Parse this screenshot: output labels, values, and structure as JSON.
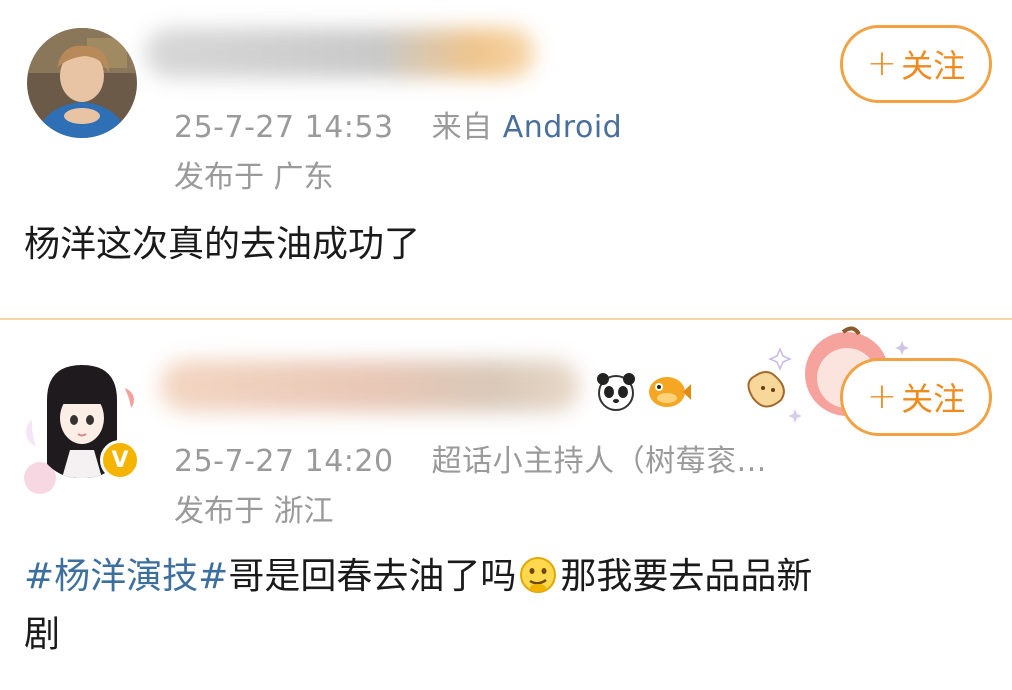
{
  "posts": [
    {
      "timestamp": "25-7-27 14:53",
      "source_prefix": "来自",
      "source": "Android",
      "location": "发布于 广东",
      "follow_label": "关注",
      "follow_plus": "+",
      "text": "杨洋这次真的去油成功了"
    },
    {
      "timestamp": "25-7-27 14:20",
      "source_prefix": "",
      "source": "超话小主持人（树莓衮...",
      "location": "发布于 浙江",
      "follow_label": "关注",
      "follow_plus": "+",
      "hashtag": "#杨洋演技#",
      "text_part1": "哥是回春去油了吗",
      "text_part2": "那我要去品品新",
      "text_line2": "剧"
    }
  ],
  "colors": {
    "follow_accent": "#ef8b1e",
    "hashtag": "#3d6f9e",
    "source_link": "#4a6f9a",
    "meta_gray": "#9a9a9a",
    "divider": "#f6d3a8"
  },
  "icons": [
    "panda-emoji-icon",
    "pufferfish-emoji-icon",
    "smirk-emoji-icon",
    "verified-v-badge-icon",
    "apple-sticker-icon"
  ]
}
